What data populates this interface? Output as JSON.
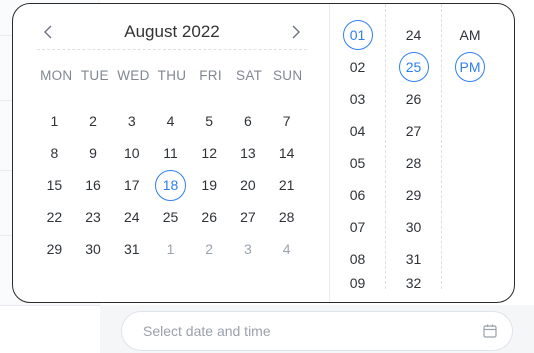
{
  "colors": {
    "accent": "#2f80ed",
    "border": "#2b2b2b"
  },
  "calendar": {
    "month_title": "August 2022",
    "prev_icon": "chevron-left-icon",
    "next_icon": "chevron-right-icon",
    "weekdays": [
      "MON",
      "TUE",
      "WED",
      "THU",
      "FRI",
      "SAT",
      "SUN"
    ],
    "days": [
      {
        "label": "1"
      },
      {
        "label": "2"
      },
      {
        "label": "3"
      },
      {
        "label": "4"
      },
      {
        "label": "5"
      },
      {
        "label": "6"
      },
      {
        "label": "7"
      },
      {
        "label": "8"
      },
      {
        "label": "9"
      },
      {
        "label": "10"
      },
      {
        "label": "11"
      },
      {
        "label": "12"
      },
      {
        "label": "13"
      },
      {
        "label": "14"
      },
      {
        "label": "15"
      },
      {
        "label": "16"
      },
      {
        "label": "17"
      },
      {
        "label": "18",
        "selected": true
      },
      {
        "label": "19"
      },
      {
        "label": "20"
      },
      {
        "label": "21"
      },
      {
        "label": "22"
      },
      {
        "label": "23"
      },
      {
        "label": "24"
      },
      {
        "label": "25"
      },
      {
        "label": "26"
      },
      {
        "label": "27"
      },
      {
        "label": "28"
      },
      {
        "label": "29"
      },
      {
        "label": "30"
      },
      {
        "label": "31"
      },
      {
        "label": "1",
        "muted": true
      },
      {
        "label": "2",
        "muted": true
      },
      {
        "label": "3",
        "muted": true
      },
      {
        "label": "4",
        "muted": true
      }
    ]
  },
  "time": {
    "hours": [
      {
        "label": "01",
        "selected": true
      },
      {
        "label": "02"
      },
      {
        "label": "03"
      },
      {
        "label": "04"
      },
      {
        "label": "05"
      },
      {
        "label": "06"
      },
      {
        "label": "07"
      },
      {
        "label": "08"
      },
      {
        "label": "09",
        "partial": true
      }
    ],
    "minutes": [
      {
        "label": "24"
      },
      {
        "label": "25",
        "selected": true
      },
      {
        "label": "26"
      },
      {
        "label": "27"
      },
      {
        "label": "28"
      },
      {
        "label": "29"
      },
      {
        "label": "30"
      },
      {
        "label": "31"
      },
      {
        "label": "32",
        "partial": true
      }
    ],
    "ampm": [
      {
        "label": "AM"
      },
      {
        "label": "PM",
        "selected": true
      }
    ]
  },
  "date_input": {
    "value": "",
    "placeholder": "Select date and time",
    "icon": "calendar-icon"
  }
}
